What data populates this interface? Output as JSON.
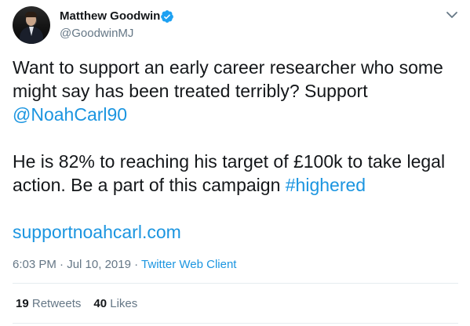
{
  "author": {
    "display_name": "Matthew Goodwin",
    "handle": "@GoodwinMJ",
    "verified": true
  },
  "tweet": {
    "para1_text": "Want to support an early career researcher who some might say has been treated terribly? Support ",
    "para1_mention": "@NoahCarl90",
    "para2_text": "He is 82% to reaching his target of £100k to take legal action. Be a part of this campaign ",
    "para2_hashtag": "#highered",
    "url": "supportnoahcarl.com"
  },
  "meta": {
    "time": "6:03 PM",
    "date": "Jul 10, 2019",
    "separator": "·",
    "source": "Twitter Web Client"
  },
  "stats": {
    "retweets_count": "19",
    "retweets_label": "Retweets",
    "likes_count": "40",
    "likes_label": "Likes"
  },
  "colors": {
    "link": "#1b95e0",
    "verified_badge": "#1da1f2",
    "muted_text": "#657786",
    "divider": "#e6ecf0"
  },
  "icons": {
    "verified": "verified-badge-icon",
    "menu": "chevron-down-icon"
  }
}
